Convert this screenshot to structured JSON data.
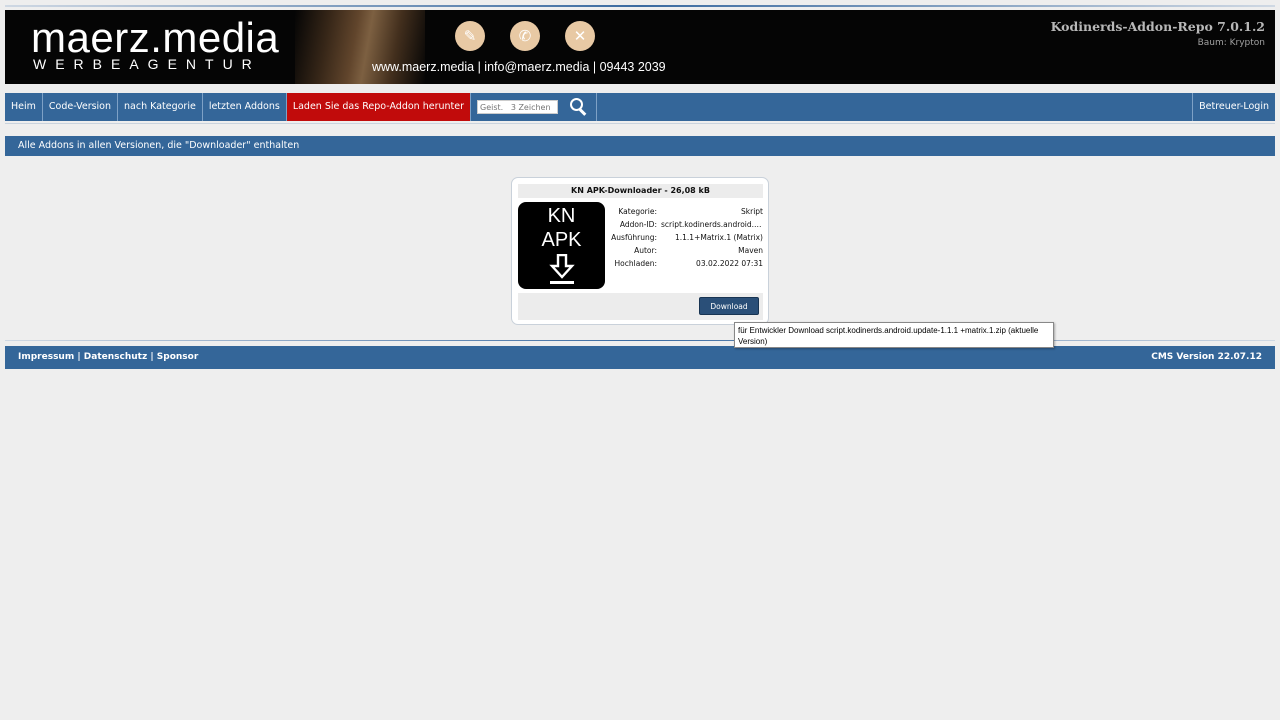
{
  "banner": {
    "brand_main": "maerz.media",
    "brand_sub": "WERBEAGENTUR",
    "contact": "www.maerz.media | info@maerz.media | 09443 2039",
    "repo_title": "Kodinerds-Addon-Repo 7.0.1.2",
    "repo_branch": "Baum: Krypton",
    "icons": [
      "monitor-icon",
      "megaphone-icon",
      "tools-icon"
    ]
  },
  "nav": {
    "home": "Heim",
    "code_version": "Code-Version",
    "by_category": "nach Kategorie",
    "latest_addons": "letzten Addons",
    "download_repo": "Laden Sie das Repo-Addon herunter",
    "search_placeholder": "Geist.   3 Zeichen",
    "login": "Betreuer-Login"
  },
  "headbar": "Alle Addons in allen Versionen, die \"Downloader\" enthalten",
  "addon": {
    "title": "KN APK-Downloader - 26,08 kB",
    "icon_line1": "KN",
    "icon_line2": "APK",
    "fields": [
      {
        "key": "Kategorie:",
        "value": "Skript"
      },
      {
        "key": "Addon-ID:",
        "value": "script.kodinerds.android.update"
      },
      {
        "key": "Ausführung:",
        "value": "1.1.1+Matrix.1 (Matrix)"
      },
      {
        "key": "Autor:",
        "value": "Maven"
      },
      {
        "key": "Hochladen:",
        "value": "03.02.2022 07:31"
      }
    ],
    "download_label": "Download",
    "tooltip": "für Entwickler Download script.kodinerds.android.update-1.1.1 +matrix.1.zip (aktuelle Version)"
  },
  "footer": {
    "impressum": "Impressum",
    "datenschutz": "Datenschutz",
    "sponsor": "Sponsor",
    "separator": "|",
    "cms_version": "CMS Version 22.07.12"
  },
  "colors": {
    "nav_blue": "#346699",
    "highlight_red": "#c10b0b",
    "button_blue": "#2a4f78"
  }
}
